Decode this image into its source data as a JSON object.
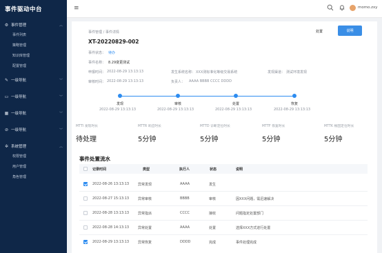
{
  "app": {
    "title": "事件驱动中台"
  },
  "sidebar": {
    "groups": [
      {
        "label": "事件管理",
        "icon": "gear-icon",
        "expanded": true,
        "items": [
          "事件列表",
          "策略管理",
          "知识库管理",
          "配置管理"
        ]
      },
      {
        "label": "一级导航",
        "icon": "edit-icon",
        "expanded": false,
        "items": []
      },
      {
        "label": "一级导航",
        "icon": "monitor-icon",
        "expanded": false,
        "items": []
      },
      {
        "label": "一级导航",
        "icon": "grid-icon",
        "expanded": false,
        "items": []
      },
      {
        "label": "一级导航",
        "icon": "check-circle-icon",
        "expanded": false,
        "items": []
      },
      {
        "label": "系统管理",
        "icon": "settings-icon",
        "expanded": true,
        "items": [
          "权限管理",
          "用户管理",
          "角色管理"
        ]
      }
    ]
  },
  "header": {
    "username": "momo.zxy"
  },
  "breadcrumb": {
    "text": "事件管理 / 事件详情"
  },
  "actions": {
    "ghost_label": "处置",
    "primary_label": "说明"
  },
  "event": {
    "id": "XT-20220829-002",
    "status_label": "事件状态：",
    "status_value": "待办",
    "name_label": "事件名称：",
    "name_value": "8.29变更测试",
    "report_time_label": "申报时间：",
    "report_time_value": "2022-08-29  13:13:13",
    "system_label": "发生系统名称：",
    "system_value": "XXX测标准化等级交易系统",
    "channel_label": "发现渠道：",
    "channel_value": "测试环境发现",
    "review_time_label": "审核时间：",
    "review_time_value": "2022-08-29  13:13:13",
    "owner_label": "负责人：",
    "owner_value": "AAAA BBBB CCCC DDDD"
  },
  "timeline": [
    {
      "label": "发现",
      "time": "2022-08-29  13:13:13"
    },
    {
      "label": "审核",
      "time": "2022-08-29  13:13:13"
    },
    {
      "label": "处置",
      "time": "2022-08-29  13:13:13"
    },
    {
      "label": "恢复",
      "time": "2022-08-29  13:13:13"
    }
  ],
  "stats": [
    {
      "label": "MTTI 发现时长",
      "value": "待处理"
    },
    {
      "label": "MTTR 响应时长",
      "value": "5分钟"
    },
    {
      "label": "MTTD 诊断定位时长",
      "value": "5分钟"
    },
    {
      "label": "MTTF 恢复时长",
      "value": "5分钟"
    },
    {
      "label": "MTTK 根因定位时长",
      "value": "5分钟"
    }
  ],
  "flow": {
    "title": "事件处置流水",
    "columns": [
      "记录时间",
      "类型",
      "执行人",
      "状态",
      "说明"
    ],
    "rows": [
      {
        "checked": true,
        "time": "2022-08-26  13:13:13",
        "type": "异常发现",
        "executor": "AAAA",
        "status": "发生",
        "note": ""
      },
      {
        "checked": false,
        "time": "2022-08-27  15:13:13",
        "type": "异常审核",
        "executor": "BBBB",
        "status": "审核",
        "note": "因XXX问题，需迅速解决"
      },
      {
        "checked": false,
        "time": "2022-08-28  13:13:13",
        "type": "异常指派",
        "executor": "CCCC",
        "status": "接收",
        "note": "问题指定处置部门"
      },
      {
        "checked": false,
        "time": "2022-08-28  14:13:13",
        "type": "异常处置",
        "executor": "AAAA",
        "status": "处置",
        "note": "选择XXX方式进行处置"
      },
      {
        "checked": true,
        "time": "2022-08-29  13:13:13",
        "type": "异常恢复",
        "executor": "DDDD",
        "status": "完成",
        "note": "事件处理完成"
      }
    ]
  }
}
